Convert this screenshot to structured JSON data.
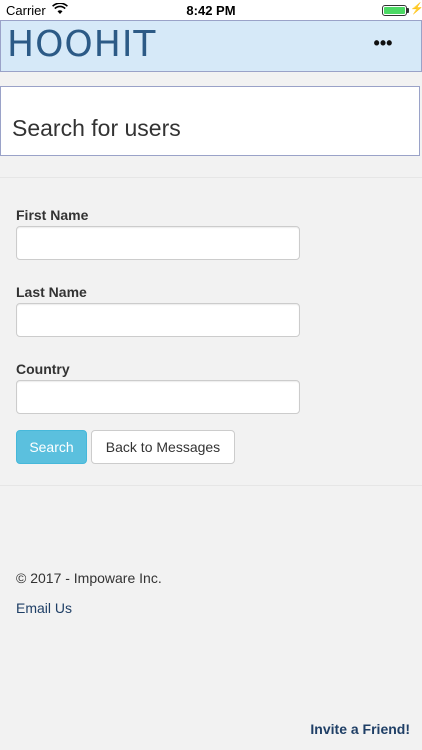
{
  "status_bar": {
    "carrier": "Carrier",
    "time": "8:42 PM",
    "battery_percent": 100,
    "battery_color": "#4cd964"
  },
  "navbar": {
    "logo_text": "HOOHIT",
    "menu_label": "•••",
    "background": "#d6e9f8"
  },
  "page": {
    "title": "Search for users"
  },
  "form": {
    "first_name_label": "First Name",
    "first_name_value": "",
    "last_name_label": "Last Name",
    "last_name_value": "",
    "country_label": "Country",
    "country_value": "",
    "search_label": "Search",
    "back_label": "Back to Messages"
  },
  "footer": {
    "copyright": "© 2017 - Impoware Inc.",
    "email_link": "Email Us",
    "invite_link": "Invite a Friend!"
  },
  "colors": {
    "accent": "#5bc0de",
    "link": "#1f3f66"
  }
}
